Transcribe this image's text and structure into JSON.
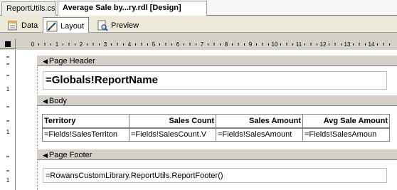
{
  "document_tabs": [
    {
      "label": "ReportUtils.cs",
      "active": false
    },
    {
      "label": "Average Sale by...ry.rdl [Design]",
      "active": true
    }
  ],
  "view_tabs": [
    {
      "label": "Data",
      "icon": "data-icon"
    },
    {
      "label": "Layout",
      "icon": "layout-icon"
    },
    {
      "label": "Preview",
      "icon": "preview-icon"
    }
  ],
  "ruler": {
    "labels": [
      "0",
      "1",
      "2",
      "3",
      "4",
      "5",
      "6",
      "7",
      "8",
      "9",
      "10",
      "11",
      "12",
      "13",
      "14"
    ]
  },
  "vertical_ruler": {
    "labels": [
      "1",
      "1",
      "1"
    ]
  },
  "sections": {
    "page_header": {
      "label": "Page Header",
      "title_expression": "=Globals!ReportName"
    },
    "body": {
      "label": "Body",
      "table": {
        "headers": [
          "Territory",
          "Sales Count",
          "Sales Amount",
          "Avg Sale Amount"
        ],
        "row": [
          "=Fields!SalesTerriton",
          "=Fields!SalesCount.V",
          "=Fields!SalesAmount",
          "=Fields!SalesAmoun"
        ]
      }
    },
    "page_footer": {
      "label": "Page Footer",
      "footer_expression": "=RowansCustomLibrary.ReportUtils.ReportFooter()"
    }
  },
  "colors": {
    "chrome": "#d4d0c8",
    "canvas": "#ffffff"
  }
}
